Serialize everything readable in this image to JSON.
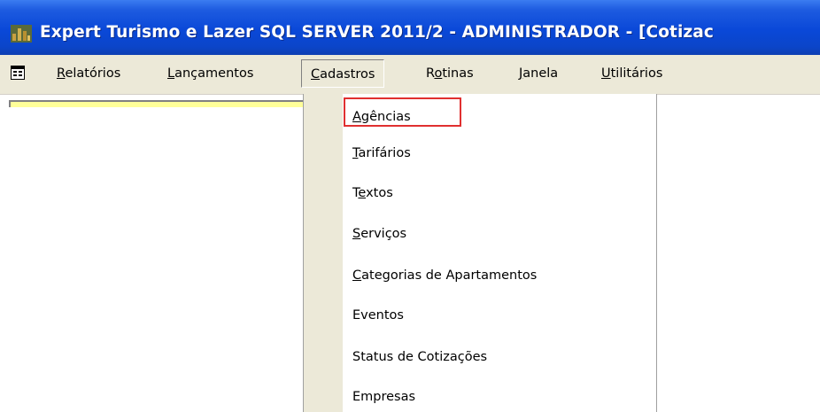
{
  "window": {
    "title": "Expert Turismo e Lazer SQL SERVER 2011/2 - ADMINISTRADOR - [Cotizac",
    "icon": "app-logo-icon"
  },
  "menubar": {
    "system_icon": "mdi-child-system-icon",
    "items": [
      {
        "label_ul": "R",
        "label_rest": "elatórios",
        "label": "Relatórios"
      },
      {
        "label_ul": "L",
        "label_rest": "ançamentos",
        "label": "Lançamentos"
      },
      {
        "label_ul": "C",
        "label_rest": "adastros",
        "label": "Cadastros",
        "open": true
      },
      {
        "label_pre": "R",
        "label_ul": "o",
        "label_rest": "tinas",
        "label": "Rotinas"
      },
      {
        "label_ul": "J",
        "label_rest": "anela",
        "label": "Janela"
      },
      {
        "label_ul": "U",
        "label_rest": "tilitários",
        "label": "Utilitários"
      }
    ]
  },
  "dropdown": {
    "items": [
      {
        "label_ul": "A",
        "label_rest": "gências",
        "label": "Agências",
        "highlighted": true
      },
      {
        "label_ul": "T",
        "label_rest": "arifários",
        "label": "Tarifários"
      },
      {
        "label_pre": "T",
        "label_ul": "e",
        "label_rest": "xtos",
        "label": "Textos"
      },
      {
        "label_ul": "S",
        "label_rest": "erviços",
        "label": "Serviços"
      },
      {
        "label_ul": "C",
        "label_rest": "ategorias de Apartamentos",
        "label": "Categorias de Apartamentos"
      },
      {
        "label_pre": "",
        "label_ul": "",
        "label_rest": "Eventos",
        "label": "Eventos"
      },
      {
        "label_pre": "",
        "label_ul": "",
        "label_rest": "Status de Cotizações",
        "label": "Status de Cotizações"
      },
      {
        "label_pre": "",
        "label_ul": "",
        "label_rest": "Empresas",
        "label": "Empresas"
      }
    ]
  },
  "colors": {
    "titlebar": "#0a48d8",
    "menubar": "#ece9d8",
    "highlight_border": "#e03030",
    "yellow_field": "#ffff99"
  }
}
